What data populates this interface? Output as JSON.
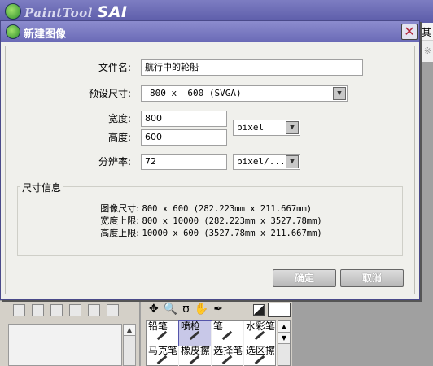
{
  "app": {
    "title_brand": "PaintTool",
    "title_product": "SAI",
    "menu_fragment": "其",
    "toolbar_fragment": "※"
  },
  "dialog": {
    "title": "新建图像",
    "close_glyph": "✕",
    "fields": {
      "filename_label": "文件名:",
      "filename_value": "航行中的轮船",
      "preset_label": "预设尺寸:",
      "preset_value": "800 x  600 (SVGA)",
      "width_label": "宽度:",
      "width_value": "800",
      "height_label": "高度:",
      "height_value": "600",
      "unit_value": "pixel",
      "resolution_label": "分辨率:",
      "resolution_value": "72",
      "resolution_unit_value": "pixel/..."
    },
    "size_info": {
      "group_title": "尺寸信息",
      "rows": [
        {
          "key": "图像尺寸:",
          "value": "800 x 600 (282.223mm x 211.667mm)"
        },
        {
          "key": "宽度上限:",
          "value": "800 x 10000 (282.223mm x 3527.78mm)"
        },
        {
          "key": "高度上限:",
          "value": "10000 x 600 (3527.78mm x 211.667mm)"
        }
      ]
    },
    "buttons": {
      "ok": "确定",
      "cancel": "取消"
    }
  },
  "tool_panel": {
    "tools": [
      "✥",
      "🔍",
      "ʊ",
      "✋",
      "✒"
    ],
    "brushes": [
      {
        "label": "铅笔",
        "selected": false
      },
      {
        "label": "喷枪",
        "selected": true
      },
      {
        "label": "笔",
        "selected": false
      },
      {
        "label": "水彩笔",
        "selected": false
      },
      {
        "label": "马克笔",
        "selected": false
      },
      {
        "label": "橡皮擦",
        "selected": false
      },
      {
        "label": "选择笔",
        "selected": false
      },
      {
        "label": "选区擦",
        "selected": false
      }
    ]
  },
  "colors": {
    "titlebar": "#6a6ab6",
    "dialog_bg": "#f0f0ec",
    "close_x": "#b2253a"
  }
}
